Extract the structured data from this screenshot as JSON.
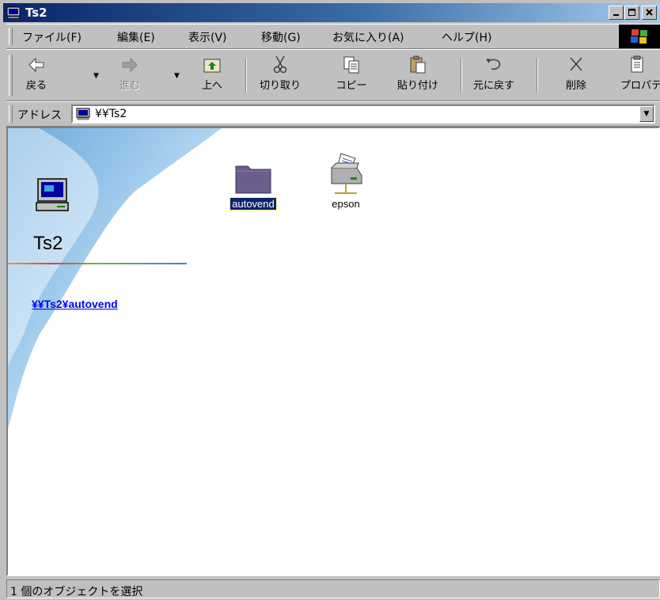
{
  "window": {
    "title": "Ts2"
  },
  "menu": [
    "ファイル(F)",
    "編集(E)",
    "表示(V)",
    "移動(G)",
    "お気に入り(A)",
    "ヘルプ(H)"
  ],
  "toolbar": {
    "back": "戻る",
    "forward": "進む",
    "up": "上へ",
    "cut": "切り取り",
    "copy": "コピー",
    "paste": "貼り付け",
    "undo": "元に戻す",
    "delete": "削除",
    "properties": "プロパティ"
  },
  "address": {
    "label": "アドレス",
    "value": "¥¥Ts2"
  },
  "sidebar": {
    "title": "Ts2",
    "link": "¥¥Ts2¥autovend"
  },
  "items": [
    {
      "label": "autovend",
      "icon": "folder-icon",
      "selected": true
    },
    {
      "label": "epson",
      "icon": "printer-icon",
      "selected": false
    }
  ],
  "status": {
    "text": "1 個のオブジェクトを選択"
  }
}
